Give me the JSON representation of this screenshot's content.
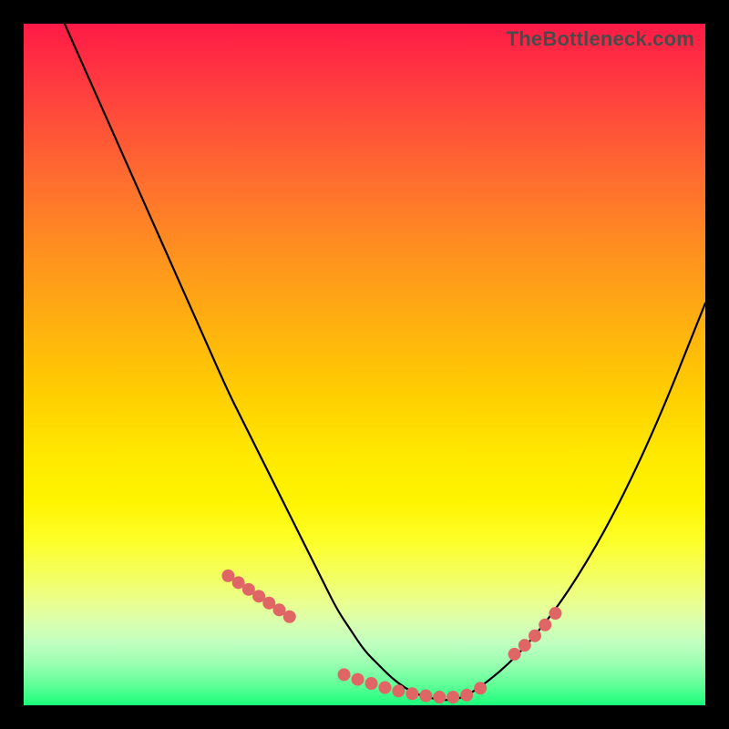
{
  "watermark": "TheBottleneck.com",
  "chart_data": {
    "type": "line",
    "title": "",
    "xlabel": "",
    "ylabel": "",
    "xlim": [
      0,
      100
    ],
    "ylim": [
      0,
      100
    ],
    "x": [
      6,
      10,
      14,
      18,
      22,
      26,
      30,
      32,
      34,
      36,
      38,
      40,
      42,
      44,
      46,
      48,
      50,
      52,
      54,
      56,
      58,
      60,
      62,
      64,
      66,
      70,
      74,
      78,
      82,
      86,
      90,
      94,
      98,
      100
    ],
    "values": [
      100,
      91,
      82,
      73,
      64,
      55,
      46,
      42,
      38,
      34,
      30,
      26,
      22,
      18,
      14,
      11,
      8,
      6,
      4,
      2.5,
      1.5,
      1,
      0.7,
      1,
      2,
      5,
      9,
      14,
      20,
      27,
      35,
      44,
      54,
      59
    ],
    "markers": {
      "x": [
        30,
        31.5,
        33,
        34.5,
        36,
        37.5,
        39,
        47,
        49,
        51,
        53,
        55,
        57,
        59,
        61,
        63,
        65,
        67,
        72,
        73.5,
        75,
        76.5,
        78
      ],
      "y": [
        19,
        18,
        17,
        16,
        15,
        14,
        13,
        4.5,
        3.8,
        3.2,
        2.6,
        2.1,
        1.7,
        1.4,
        1.2,
        1.2,
        1.5,
        2.5,
        7.5,
        8.8,
        10.2,
        11.8,
        13.5
      ]
    },
    "grid": false,
    "legend": false
  }
}
